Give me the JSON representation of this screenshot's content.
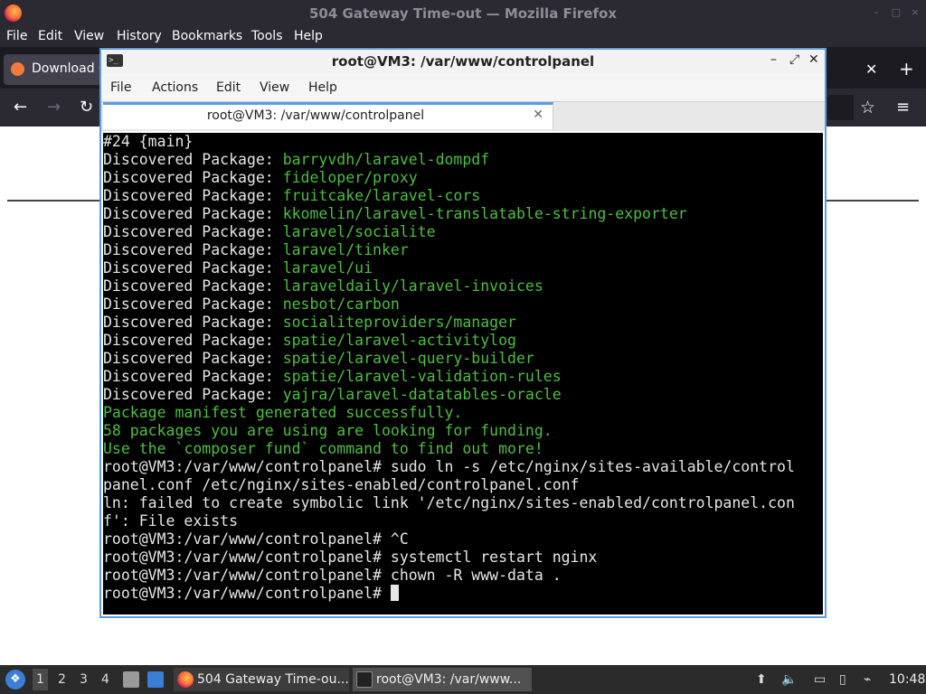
{
  "firefox": {
    "window_title": "504 Gateway Time-out — Mozilla Firefox",
    "menu": [
      "File",
      "Edit",
      "View",
      "History",
      "Bookmarks",
      "Tools",
      "Help"
    ],
    "tab_label": "Download Q",
    "title_controls": [
      "minimize-icon",
      "maximize-icon",
      "close-icon"
    ],
    "colors": {
      "chrome": "#2b2a33",
      "tabstrip": "#1c1b22"
    }
  },
  "terminal": {
    "title": "root@VM3: /var/www/controlpanel",
    "menu": [
      "File",
      "Actions",
      "Edit",
      "View",
      "Help"
    ],
    "tab_label": "root@VM3: /var/www/controlpanel",
    "lines": [
      {
        "text": "#24 {main}"
      },
      {
        "prefix": "Discovered Package: ",
        "pkg": "barryvdh/laravel-dompdf"
      },
      {
        "prefix": "Discovered Package: ",
        "pkg": "fideloper/proxy"
      },
      {
        "prefix": "Discovered Package: ",
        "pkg": "fruitcake/laravel-cors"
      },
      {
        "prefix": "Discovered Package: ",
        "pkg": "kkomelin/laravel-translatable-string-exporter"
      },
      {
        "prefix": "Discovered Package: ",
        "pkg": "laravel/socialite"
      },
      {
        "prefix": "Discovered Package: ",
        "pkg": "laravel/tinker"
      },
      {
        "prefix": "Discovered Package: ",
        "pkg": "laravel/ui"
      },
      {
        "prefix": "Discovered Package: ",
        "pkg": "laraveldaily/laravel-invoices"
      },
      {
        "prefix": "Discovered Package: ",
        "pkg": "nesbot/carbon"
      },
      {
        "prefix": "Discovered Package: ",
        "pkg": "socialiteproviders/manager"
      },
      {
        "prefix": "Discovered Package: ",
        "pkg": "spatie/laravel-activitylog"
      },
      {
        "prefix": "Discovered Package: ",
        "pkg": "spatie/laravel-query-builder"
      },
      {
        "prefix": "Discovered Package: ",
        "pkg": "spatie/laravel-validation-rules"
      },
      {
        "prefix": "Discovered Package: ",
        "pkg": "yajra/laravel-datatables-oracle"
      },
      {
        "green": "Package manifest generated successfully."
      },
      {
        "green": "58 packages you are using are looking for funding."
      },
      {
        "green": "Use the `composer fund` command to find out more!"
      },
      {
        "text": "root@VM3:/var/www/controlpanel# sudo ln -s /etc/nginx/sites-available/control"
      },
      {
        "text": "panel.conf /etc/nginx/sites-enabled/controlpanel.conf"
      },
      {
        "text": "ln: failed to create symbolic link '/etc/nginx/sites-enabled/controlpanel.con"
      },
      {
        "text": "f': File exists"
      },
      {
        "text": "root@VM3:/var/www/controlpanel# ^C"
      },
      {
        "text": "root@VM3:/var/www/controlpanel# systemctl restart nginx"
      },
      {
        "text": "root@VM3:/var/www/controlpanel# chown -R www-data ."
      }
    ],
    "prompt": "root@VM3:/var/www/controlpanel# ",
    "colors": {
      "background": "#000000",
      "text": "#e6e6e6",
      "green": "#4cbf3e",
      "accent": "#5a9de0"
    }
  },
  "taskbar": {
    "workspaces": [
      "1",
      "2",
      "3",
      "4"
    ],
    "tasks": [
      {
        "label": "504 Gateway Time-ou...",
        "icon": "firefox-icon"
      },
      {
        "label": "root@VM3: /var/www...",
        "icon": "terminal-icon"
      }
    ],
    "tray_icons": [
      "updates-icon",
      "volume-icon",
      "display-icon",
      "clipboard-icon",
      "network-icon"
    ],
    "clock": "10:48"
  }
}
